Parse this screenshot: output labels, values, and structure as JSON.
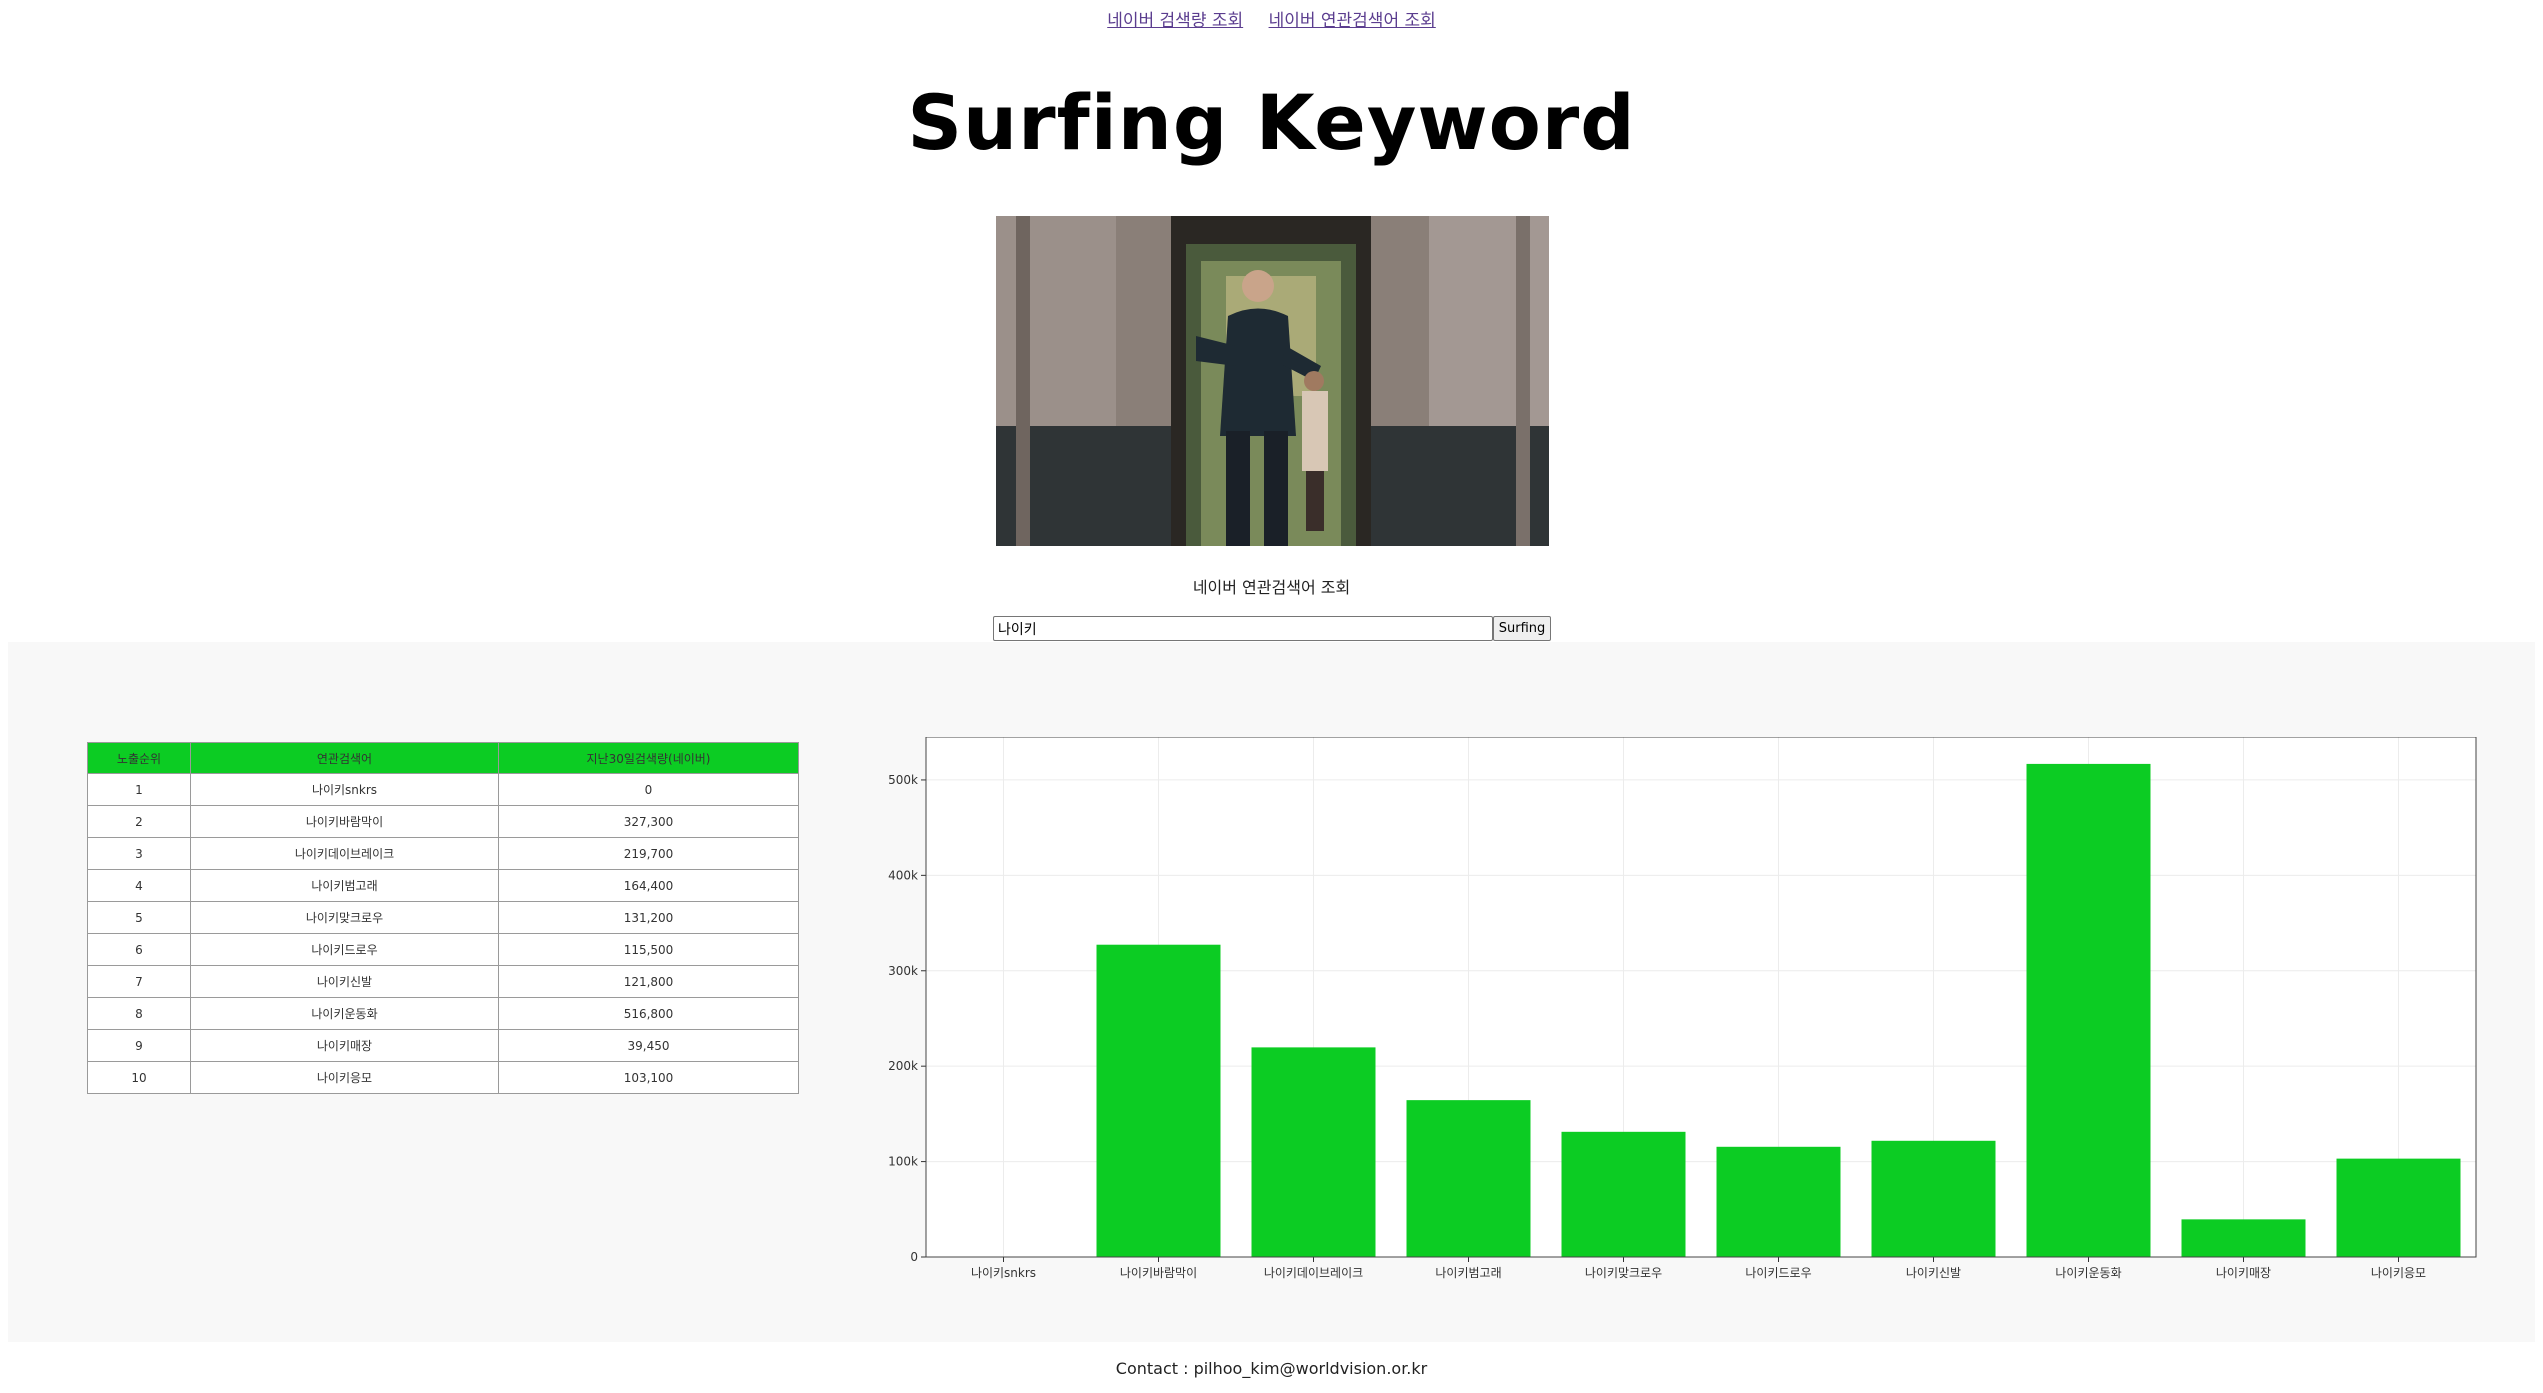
{
  "nav": {
    "links": [
      "네이버 검색량 조회",
      "네이버 연관검색어 조회"
    ]
  },
  "page_title": "Surfing Keyword",
  "hero_image": {
    "description_icon": "movie-still-image"
  },
  "subheading": "네이버 연관검색어 조회",
  "search": {
    "value": "나이키",
    "button_label": "Surfing"
  },
  "table": {
    "headers": [
      "노출순위",
      "연관검색어",
      "지난30일검색량(네이버)"
    ],
    "rows": [
      [
        "1",
        "나이키snkrs",
        "0"
      ],
      [
        "2",
        "나이키바람막이",
        "327,300"
      ],
      [
        "3",
        "나이키데이브레이크",
        "219,700"
      ],
      [
        "4",
        "나이키범고래",
        "164,400"
      ],
      [
        "5",
        "나이키맞크로우",
        "131,200"
      ],
      [
        "6",
        "나이키드로우",
        "115,500"
      ],
      [
        "7",
        "나이키신발",
        "121,800"
      ],
      [
        "8",
        "나이키운동화",
        "516,800"
      ],
      [
        "9",
        "나이키매장",
        "39,450"
      ],
      [
        "10",
        "나이키응모",
        "103,100"
      ]
    ]
  },
  "chart_data": {
    "type": "bar",
    "categories": [
      "나이키snkrs",
      "나이키바람막이",
      "나이키데이브레이크",
      "나이키범고래",
      "나이키맞크로우",
      "나이키드로우",
      "나이키신발",
      "나이키운동화",
      "나이키매장",
      "나이키응모"
    ],
    "values": [
      0,
      327300,
      219700,
      164400,
      131200,
      115500,
      121800,
      516800,
      39450,
      103100
    ],
    "ylim": [
      0,
      545000
    ],
    "yticks": [
      0,
      100000,
      200000,
      300000,
      400000,
      500000
    ],
    "ytick_labels": [
      "0",
      "100k",
      "200k",
      "300k",
      "400k",
      "500k"
    ],
    "bar_color": "#0ccc23",
    "grid": true
  },
  "footer": "Contact : pilhoo_kim@worldvision.or.kr"
}
